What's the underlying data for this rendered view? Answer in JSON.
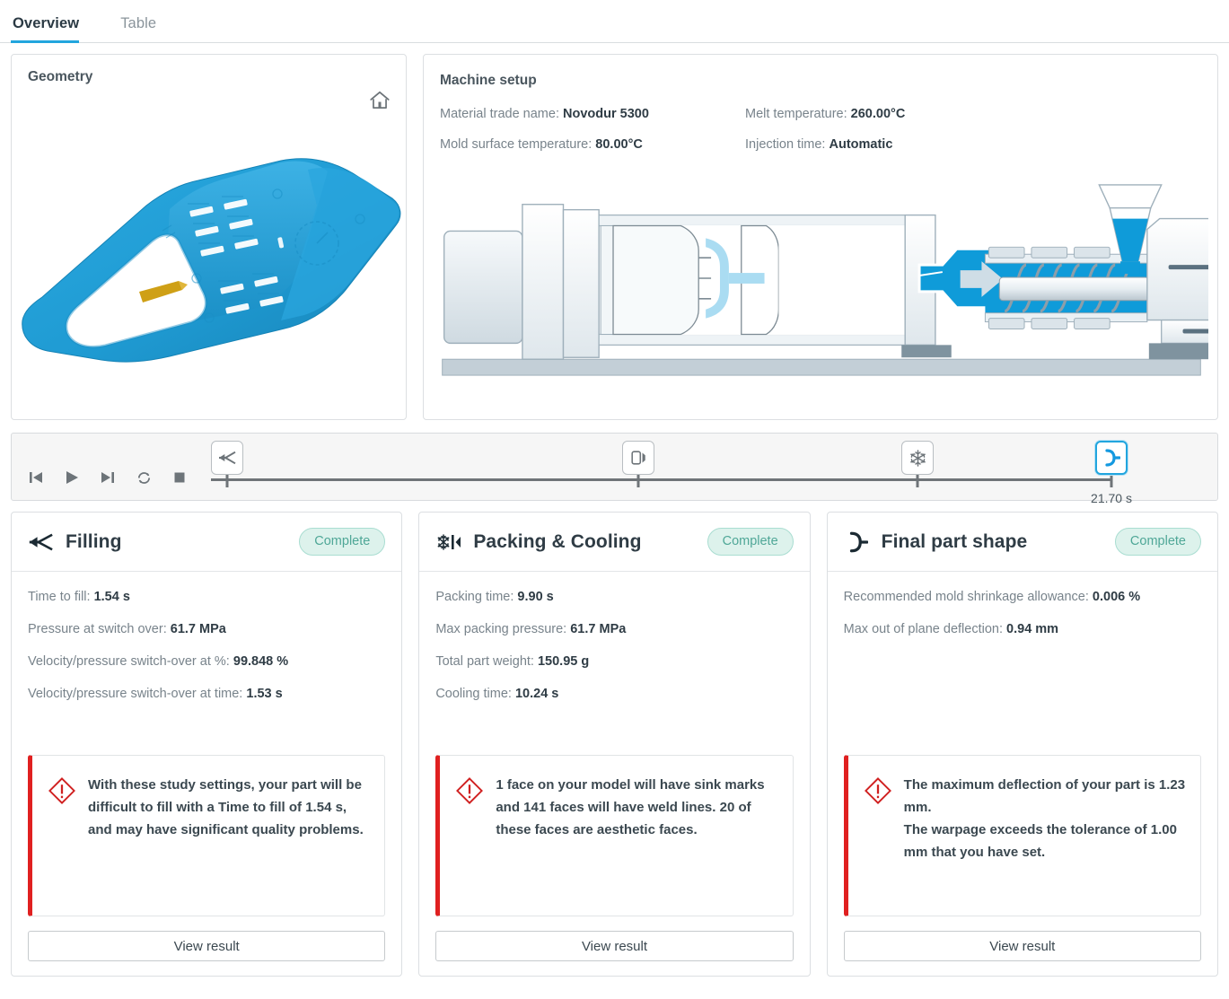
{
  "tabs": [
    {
      "label": "Overview",
      "active": true
    },
    {
      "label": "Table",
      "active": false
    }
  ],
  "geometry": {
    "title": "Geometry",
    "home_icon": "home-icon"
  },
  "machine_setup": {
    "title": "Machine setup",
    "specs": [
      {
        "label": "Material trade name:",
        "value": "Novodur 5300"
      },
      {
        "label": "Melt temperature:",
        "value": "260.00°C"
      },
      {
        "label": "Mold surface temperature:",
        "value": "80.00°C"
      },
      {
        "label": "Injection time:",
        "value": "Automatic"
      }
    ]
  },
  "timeline": {
    "transport": [
      {
        "name": "skip-to-start-button",
        "icon": "skip-back-icon"
      },
      {
        "name": "play-button",
        "icon": "play-icon"
      },
      {
        "name": "skip-to-end-button",
        "icon": "skip-forward-icon"
      },
      {
        "name": "loop-button",
        "icon": "loop-icon"
      },
      {
        "name": "stop-button",
        "icon": "stop-icon"
      }
    ],
    "markers": [
      {
        "name": "marker-filling",
        "icon": "filling-flow-icon",
        "position_pct": 0,
        "active": false
      },
      {
        "name": "marker-packing",
        "icon": "packing-icon",
        "position_pct": 47.5,
        "active": false
      },
      {
        "name": "marker-cooling",
        "icon": "snowflake-icon",
        "position_pct": 78.5,
        "active": false
      },
      {
        "name": "marker-final-part-shape",
        "icon": "final-part-shape-icon",
        "position_pct": 100,
        "active": true
      }
    ],
    "current_time": "21.70 s"
  },
  "cards": [
    {
      "icon": "filling-flow-icon",
      "title": "Filling",
      "status": "Complete",
      "metrics": [
        {
          "label": "Time to fill:",
          "value": "1.54 s"
        },
        {
          "label": "Pressure at switch over:",
          "value": "61.7 MPa"
        },
        {
          "label": "Velocity/pressure switch-over at %:",
          "value": "99.848 %"
        },
        {
          "label": "Velocity/pressure switch-over at time:",
          "value": "1.53 s"
        }
      ],
      "alert": {
        "icon": "warning-diamond-icon",
        "parts": [
          {
            "text": "With these study settings, your part will be difficult to fill with a ",
            "bold": false
          },
          {
            "text": "Time to fill",
            "bold": true
          },
          {
            "text": " of 1.54 s, and may have significant quality problems.",
            "bold": false
          }
        ]
      },
      "button": "View result"
    },
    {
      "icon": "packing-icon",
      "title": "Packing & Cooling",
      "status": "Complete",
      "metrics": [
        {
          "label": "Packing time:",
          "value": "9.90 s"
        },
        {
          "label": "Max packing pressure:",
          "value": "61.7 MPa"
        },
        {
          "label": "Total part weight:",
          "value": "150.95 g"
        },
        {
          "label": "Cooling time:",
          "value": "10.24 s"
        }
      ],
      "alert": {
        "icon": "warning-diamond-icon",
        "parts": [
          {
            "text": "1 face on your model will have sink marks and 141 faces will have weld lines. 20 of these faces are aesthetic faces.",
            "bold": false
          }
        ]
      },
      "button": "View result"
    },
    {
      "icon": "final-part-shape-icon",
      "title": "Final part shape",
      "status": "Complete",
      "metrics": [
        {
          "label": "Recommended mold shrinkage allowance:",
          "value": "0.006 %"
        },
        {
          "label": "Max out of plane deflection:",
          "value": "0.94 mm"
        }
      ],
      "alert": {
        "icon": "warning-diamond-icon",
        "parts": [
          {
            "text": "The maximum deflection of your part is 1.23 mm.\nThe warpage exceeds the tolerance of 1.00 mm that you have set.",
            "bold": false
          }
        ]
      },
      "button": "View result"
    }
  ],
  "colors": {
    "accent": "#22a5de",
    "badge_bg": "#ddf2ec",
    "badge_text": "#4fa797",
    "alert_bar": "#e02020",
    "alert_icon": "#d02020",
    "part_blue": "#1c9ad6",
    "gate_gold": "#d2a017"
  }
}
